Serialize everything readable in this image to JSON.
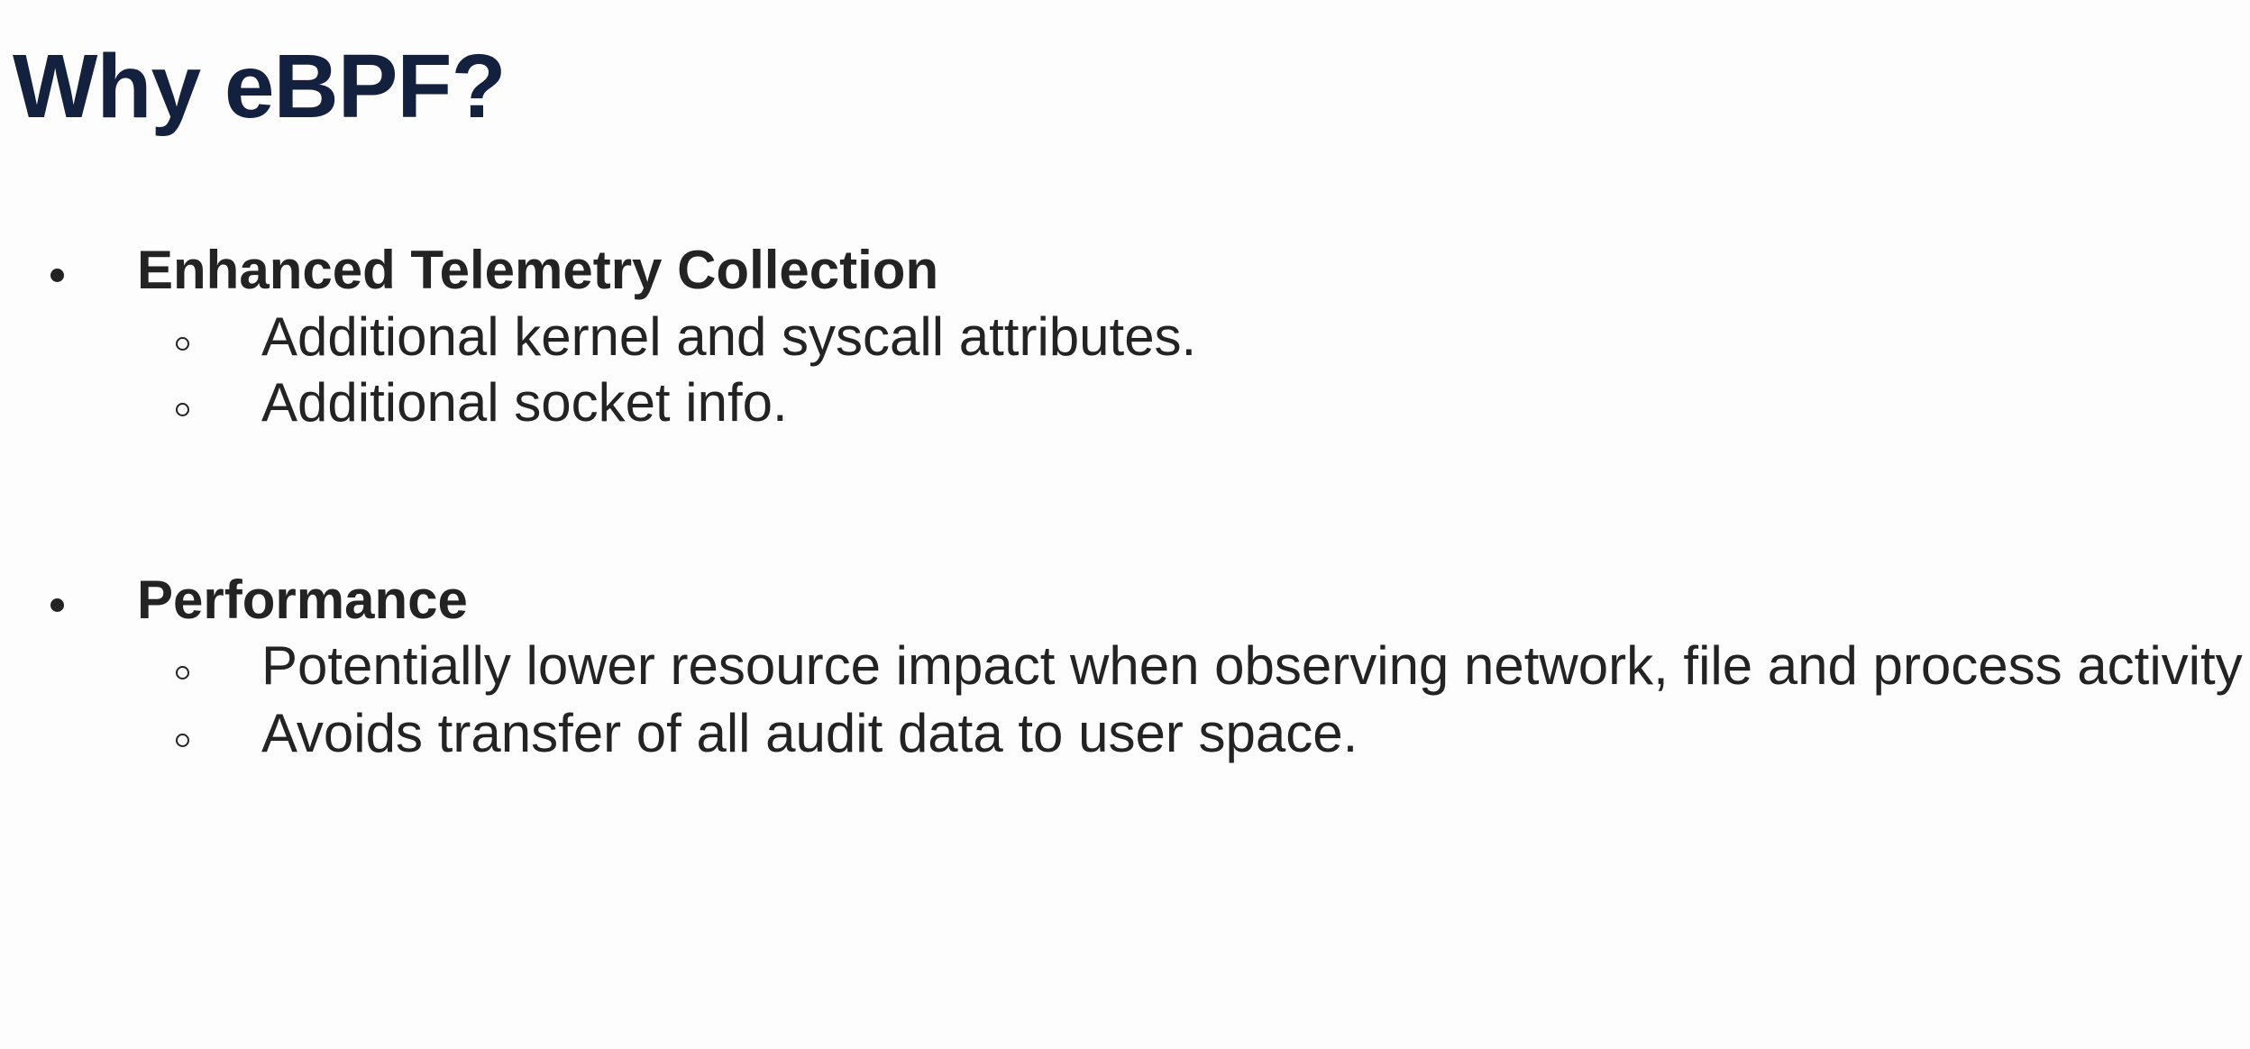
{
  "slide": {
    "title": "Why eBPF?",
    "sections": [
      {
        "heading": "Enhanced Telemetry Collection",
        "points": [
          "Additional kernel and syscall attributes.",
          "Additional socket info."
        ]
      },
      {
        "heading": "Performance",
        "points": [
          "Potentially lower resource impact when observing network, file and process activity",
          "Avoids transfer of all audit data to user space."
        ]
      }
    ]
  },
  "colors": {
    "title": "#13213f",
    "body_text": "#232323",
    "background": "#fdfdfe"
  }
}
